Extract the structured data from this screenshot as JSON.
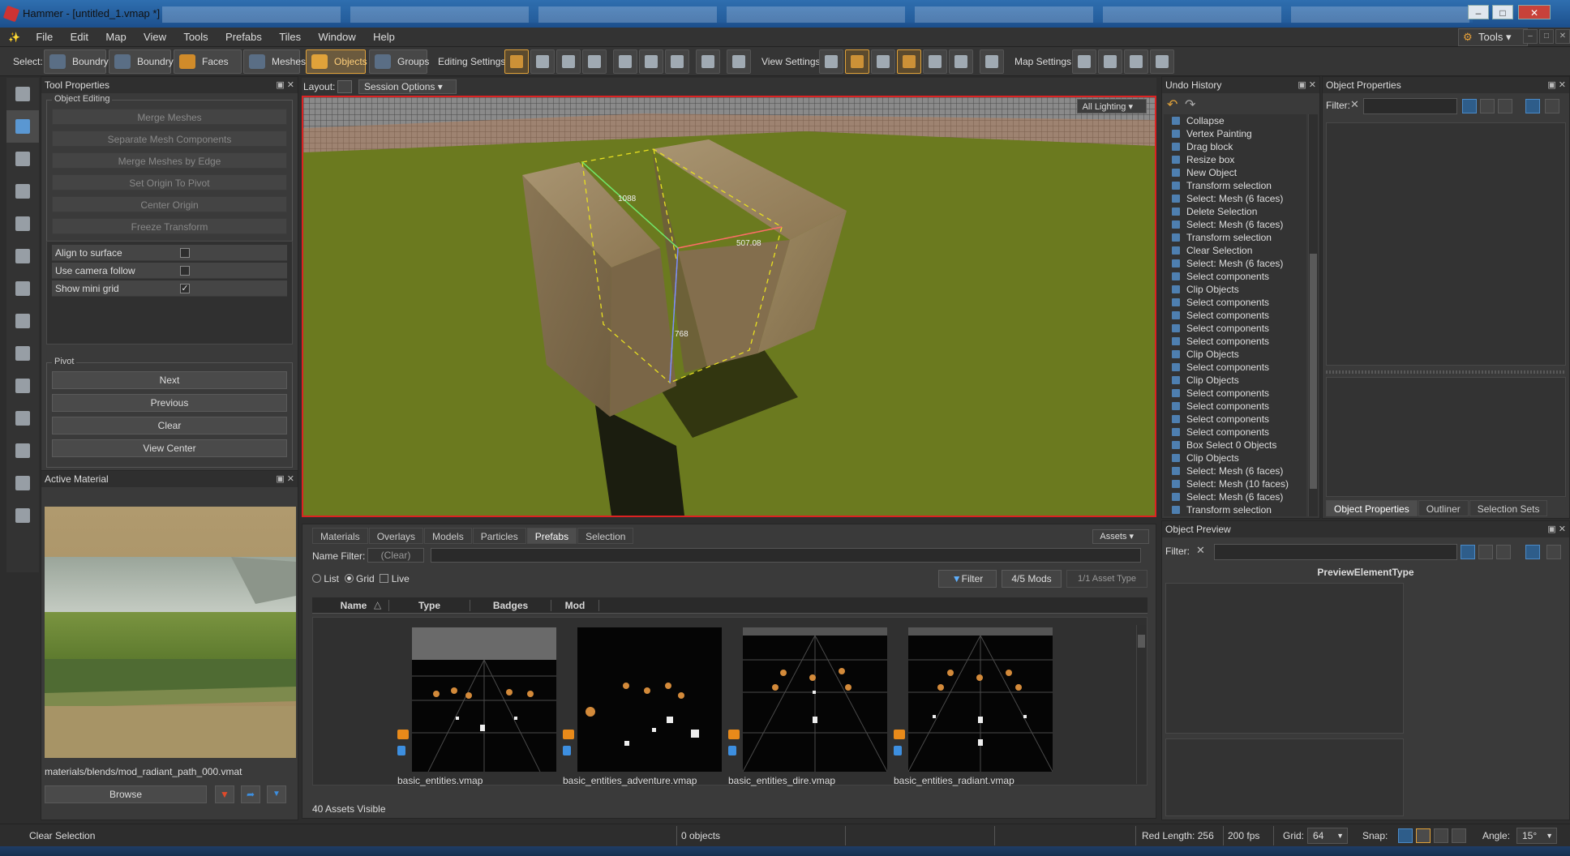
{
  "window": {
    "title": "Hammer - [untitled_1.vmap *]"
  },
  "menu": [
    "File",
    "Edit",
    "Map",
    "View",
    "Tools",
    "Prefabs",
    "Tiles",
    "Window",
    "Help"
  ],
  "tools_menu": "Tools",
  "toolbar": {
    "select_label": "Select:",
    "select_modes": [
      "Boundry",
      "Boundry",
      "Faces",
      "Meshes",
      "Objects",
      "Groups"
    ],
    "editing_label": "Editing Settings:",
    "view_label": "View Settings:",
    "map_label": "Map Settings:"
  },
  "tool_properties": {
    "title": "Tool Properties",
    "group": "Object Editing",
    "actions": [
      "Merge Meshes",
      "Separate Mesh Components",
      "Merge Meshes by Edge",
      "Set Origin To Pivot",
      "Center Origin",
      "Freeze Transform"
    ],
    "checks": [
      {
        "label": "Align to surface",
        "checked": false
      },
      {
        "label": "Use camera follow",
        "checked": false
      },
      {
        "label": "Show mini grid",
        "checked": true
      }
    ],
    "pivot_group": "Pivot",
    "pivot_buttons": [
      "Next",
      "Previous",
      "Clear",
      "View Center"
    ]
  },
  "active_material": {
    "title": "Active Material",
    "path": "materials/blends/mod_radiant_path_000.vmat",
    "browse": "Browse"
  },
  "viewport": {
    "layout_label": "Layout:",
    "session_options": "Session Options",
    "lighting": "All Lighting",
    "dim_green": "1088",
    "dim_red": "507.08",
    "dim_blue": "768"
  },
  "asset_browser": {
    "tabs": [
      "Materials",
      "Overlays",
      "Models",
      "Particles",
      "Prefabs",
      "Selection"
    ],
    "active_tab": "Prefabs",
    "assets_button": "Assets",
    "name_filter_label": "Name Filter:",
    "clear": "(Clear)",
    "view_modes": [
      "List",
      "Grid"
    ],
    "live": "Live",
    "filter": "Filter",
    "mods": "4/5 Mods",
    "asset_types": "1/1 Asset Type",
    "columns": [
      "Name",
      "Type",
      "Badges",
      "Mod"
    ],
    "items": [
      "basic_entities.vmap",
      "basic_entities_adventure.vmap",
      "basic_entities_dire.vmap",
      "basic_entities_radiant.vmap"
    ],
    "count": "40 Assets Visible"
  },
  "undo_history": {
    "title": "Undo History",
    "items": [
      "Collapse",
      "Vertex Painting",
      "Drag block",
      "Resize box",
      "New Object",
      "Transform selection",
      "Select: Mesh (6 faces)",
      "Delete Selection",
      "Select: Mesh (6 faces)",
      "Transform selection",
      "Clear Selection",
      "Select: Mesh (6 faces)",
      "Select components",
      "Clip Objects",
      "Select components",
      "Select components",
      "Select components",
      "Select components",
      "Clip Objects",
      "Select components",
      "Clip Objects",
      "Select components",
      "Select components",
      "Select components",
      "Select components",
      "Box Select 0 Objects",
      "Clip Objects",
      "Select: Mesh (6 faces)",
      "Select: Mesh (10 faces)",
      "Select: Mesh (6 faces)",
      "Transform selection"
    ]
  },
  "object_properties": {
    "title": "Object Properties",
    "filter_label": "Filter:",
    "tabs": [
      "Object Properties",
      "Outliner",
      "Selection Sets"
    ]
  },
  "object_preview": {
    "title": "Object Preview",
    "filter_label": "Filter:",
    "heading": "PreviewElementType"
  },
  "status": {
    "last_action": "Clear Selection",
    "objects": "0 objects",
    "red_length": "Red Length: 256",
    "fps": "200 fps",
    "grid_label": "Grid:",
    "grid_value": "64",
    "snap_label": "Snap:",
    "angle_label": "Angle:",
    "angle_value": "15°"
  },
  "colors": {
    "accent": "#e0a23a",
    "selection_red": "#dd2222",
    "ground": "#6e7a1c"
  }
}
